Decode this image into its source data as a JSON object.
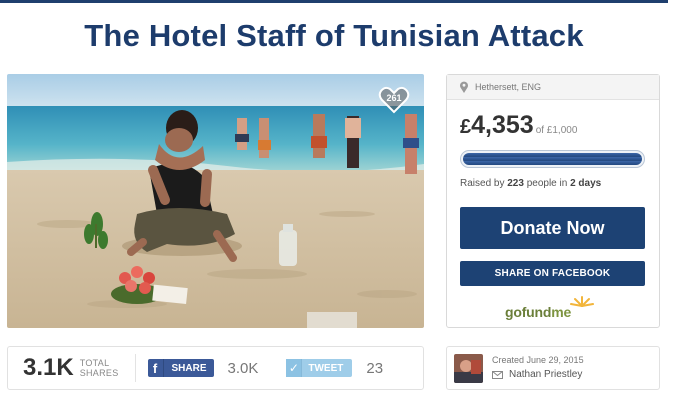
{
  "title": "The Hotel Staff of Tunisian Attack",
  "hero": {
    "heart_count": "261"
  },
  "card": {
    "location": "Hethersett, ENG",
    "currency": "£",
    "amount": "4,353",
    "goal": "of £1,000",
    "progress_fraction": 1.0,
    "raised_prefix": "Raised by ",
    "raised_people": "223",
    "raised_mid": " people in ",
    "raised_days": "2 days",
    "donate_label": "Donate Now",
    "facebook_label": "SHARE ON FACEBOOK",
    "logo_text_a": "gofund",
    "logo_text_b": "me"
  },
  "share_bar": {
    "total": "3.1K",
    "total_label_1": "TOTAL",
    "total_label_2": "SHARES",
    "fb_label": "SHARE",
    "fb_count": "3.0K",
    "tw_label": "TWEET",
    "tw_count": "23"
  },
  "organizer": {
    "created": "Created June 29, 2015",
    "name": "Nathan Priestley"
  },
  "colors": {
    "brand_navy": "#1d4274",
    "facebook_blue": "#3b5998",
    "twitter_blue": "#9fcde9",
    "gofundme_green": "#6b7f3a"
  },
  "icons": [
    "heart-icon",
    "location-pin-icon",
    "facebook-icon",
    "twitter-icon",
    "mail-icon",
    "gofundme-sun-icon"
  ]
}
